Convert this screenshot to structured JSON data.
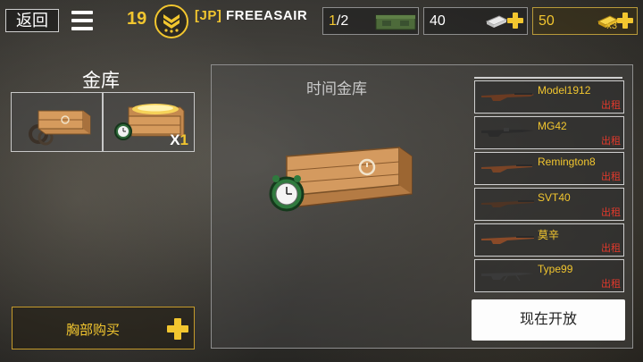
{
  "topbar": {
    "back_label": "返回",
    "level": "19",
    "player_tag": "[JP]",
    "player_name": "FREEASAIR",
    "crates": {
      "current": "1",
      "total": "/2"
    },
    "cash": "40",
    "gold": "50",
    "gold_multiplier": "x3"
  },
  "left": {
    "title": "金库",
    "slot2_count_prefix": "X",
    "slot2_count": "1",
    "buy_label": "胸部购买"
  },
  "main": {
    "chest_name": "时间金库",
    "weapons": [
      {
        "name": "Model1912",
        "tag": "出租"
      },
      {
        "name": "MG42",
        "tag": "出租"
      },
      {
        "name": "Remington8",
        "tag": "出租"
      },
      {
        "name": "SVT40",
        "tag": "出租"
      },
      {
        "name": "莫辛",
        "tag": "出租"
      },
      {
        "name": "Type99",
        "tag": "出租"
      }
    ],
    "open_label": "现在开放"
  },
  "colors": {
    "accent": "#f2c62f",
    "rent": "#e0392c",
    "panel_border": "#cfcfcf"
  }
}
